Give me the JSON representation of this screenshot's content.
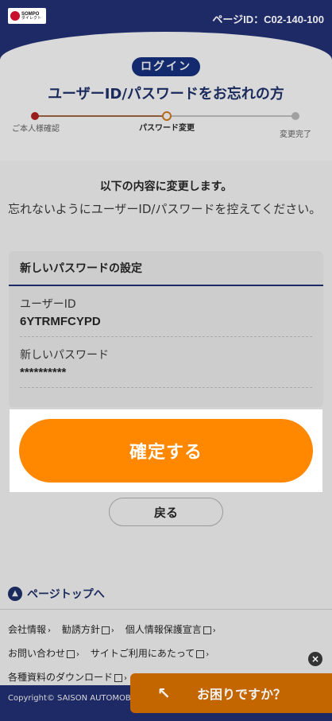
{
  "header": {
    "logo_main": "SOMPO",
    "logo_sub": "ダイレクト",
    "page_id": "ページID：C02-140-100"
  },
  "hero": {
    "badge": "ログイン",
    "title": "ユーザーID/パスワードをお忘れの方"
  },
  "stepper": {
    "steps": [
      {
        "label": "ご本人様確認",
        "state": "done"
      },
      {
        "label": "パスワード変更",
        "state": "current"
      },
      {
        "label": "変更完了",
        "state": "todo"
      }
    ]
  },
  "main": {
    "subheading": "以下の内容に変更します。",
    "notice": "忘れないようにユーザーID/パスワードを控えてください。",
    "card": {
      "title": "新しいパスワードの設定",
      "fields": [
        {
          "label": "ユーザーID",
          "value": "6YTRMFCYPD"
        },
        {
          "label": "新しいパスワード",
          "value": "**********"
        }
      ]
    },
    "confirm_label": "確定する",
    "back_label": "戻る"
  },
  "footer": {
    "to_top": "ページトップへ",
    "links": [
      "会社情報",
      "勧誘方針",
      "個人情報保護宣言",
      "お問い合わせ",
      "サイトご利用にあたって",
      "各種資料のダウンロード"
    ],
    "copyright": "Copyright© SAISON AUTOMOB... Reserved."
  },
  "help": {
    "label": "お困りですか？"
  },
  "colors": {
    "navy": "#1d2a66",
    "orange": "#ff8800",
    "help_orange": "#c46600"
  }
}
